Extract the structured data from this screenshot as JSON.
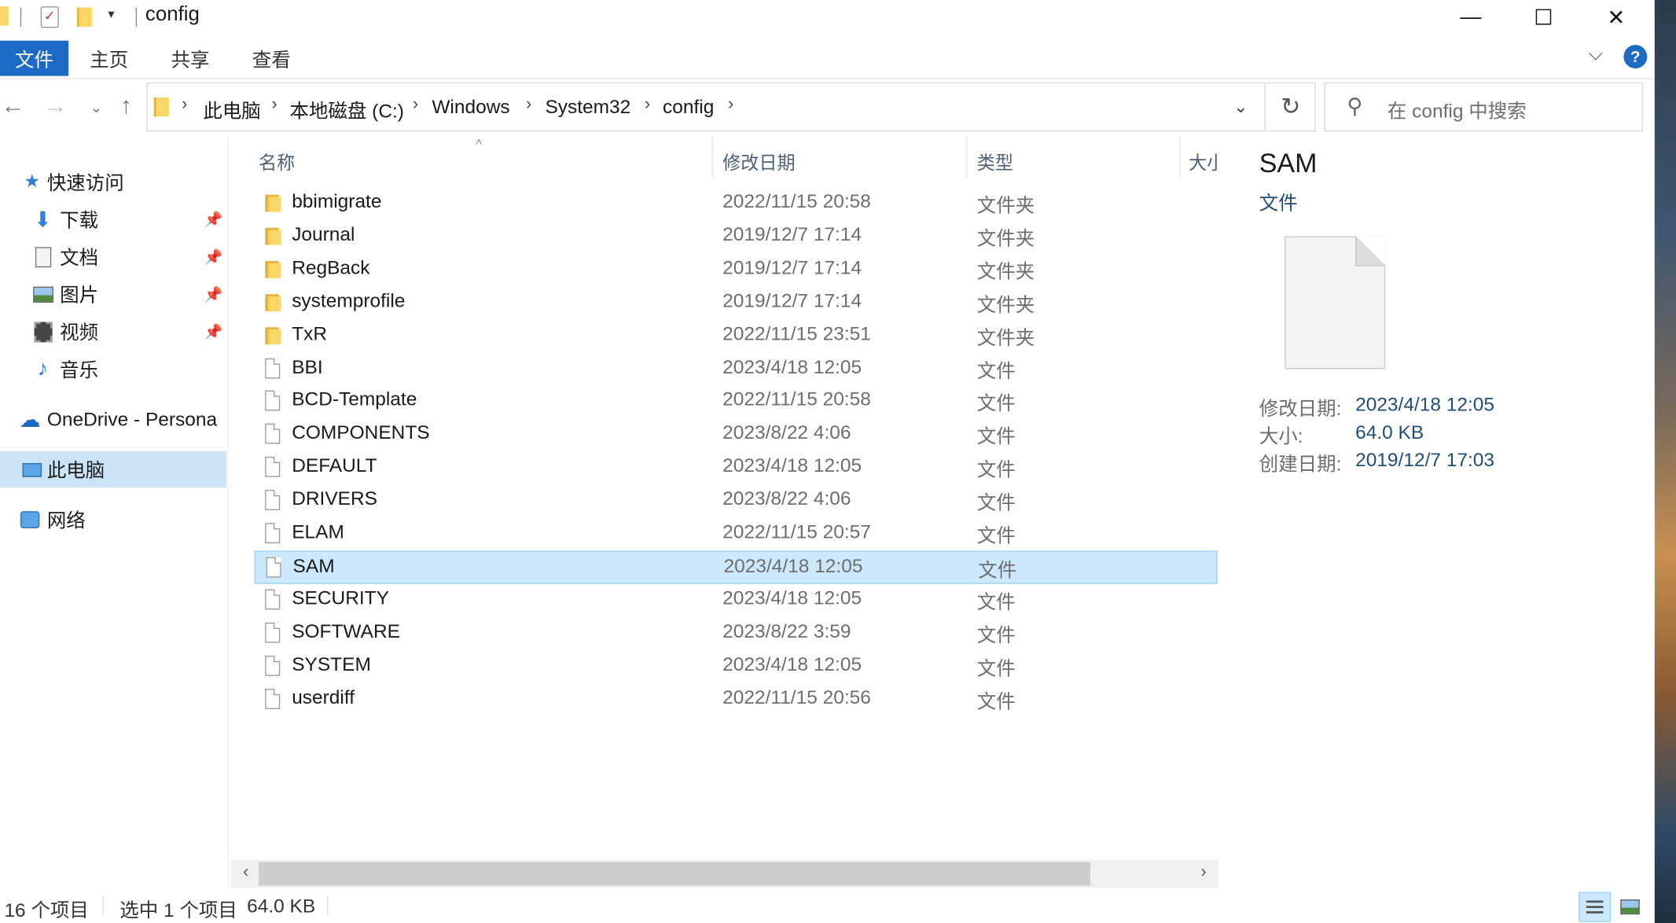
{
  "window": {
    "title": "config",
    "minimize": "—",
    "maximize": "☐",
    "close": "✕"
  },
  "ribbon": {
    "tabs": [
      "文件",
      "主页",
      "共享",
      "查看"
    ],
    "help": "?"
  },
  "address": {
    "crumbs": [
      "此电脑",
      "本地磁盘 (C:)",
      "Windows",
      "System32",
      "config"
    ],
    "search_placeholder": "在 config 中搜索"
  },
  "sidebar": {
    "quick_access": "快速访问",
    "items": [
      {
        "label": "下载",
        "icon": "download-icon",
        "pinned": true
      },
      {
        "label": "文档",
        "icon": "documents-icon",
        "pinned": true
      },
      {
        "label": "图片",
        "icon": "pictures-icon",
        "pinned": true
      },
      {
        "label": "视频",
        "icon": "videos-icon",
        "pinned": true
      },
      {
        "label": "音乐",
        "icon": "music-icon",
        "pinned": false
      }
    ],
    "onedrive": "OneDrive - Persona",
    "this_pc": "此电脑",
    "network": "网络"
  },
  "columns": {
    "name": "名称",
    "date": "修改日期",
    "type": "类型",
    "size": "大小"
  },
  "files": [
    {
      "name": "bbimigrate",
      "date": "2022/11/15 20:58",
      "type": "文件夹",
      "kind": "folder"
    },
    {
      "name": "Journal",
      "date": "2019/12/7 17:14",
      "type": "文件夹",
      "kind": "folder"
    },
    {
      "name": "RegBack",
      "date": "2019/12/7 17:14",
      "type": "文件夹",
      "kind": "folder"
    },
    {
      "name": "systemprofile",
      "date": "2019/12/7 17:14",
      "type": "文件夹",
      "kind": "folder"
    },
    {
      "name": "TxR",
      "date": "2022/11/15 23:51",
      "type": "文件夹",
      "kind": "folder"
    },
    {
      "name": "BBI",
      "date": "2023/4/18 12:05",
      "type": "文件",
      "kind": "file"
    },
    {
      "name": "BCD-Template",
      "date": "2022/11/15 20:58",
      "type": "文件",
      "kind": "file"
    },
    {
      "name": "COMPONENTS",
      "date": "2023/8/22 4:06",
      "type": "文件",
      "kind": "file"
    },
    {
      "name": "DEFAULT",
      "date": "2023/4/18 12:05",
      "type": "文件",
      "kind": "file"
    },
    {
      "name": "DRIVERS",
      "date": "2023/8/22 4:06",
      "type": "文件",
      "kind": "file"
    },
    {
      "name": "ELAM",
      "date": "2022/11/15 20:57",
      "type": "文件",
      "kind": "file"
    },
    {
      "name": "SAM",
      "date": "2023/4/18 12:05",
      "type": "文件",
      "kind": "file",
      "selected": true
    },
    {
      "name": "SECURITY",
      "date": "2023/4/18 12:05",
      "type": "文件",
      "kind": "file"
    },
    {
      "name": "SOFTWARE",
      "date": "2023/8/22 3:59",
      "type": "文件",
      "kind": "file"
    },
    {
      "name": "SYSTEM",
      "date": "2023/4/18 12:05",
      "type": "文件",
      "kind": "file"
    },
    {
      "name": "userdiff",
      "date": "2022/11/15 20:56",
      "type": "文件",
      "kind": "file"
    }
  ],
  "preview": {
    "title": "SAM",
    "type": "文件",
    "modified_label": "修改日期:",
    "modified_value": "2023/4/18 12:05",
    "size_label": "大小:",
    "size_value": "64.0 KB",
    "created_label": "创建日期:",
    "created_value": "2019/12/7 17:03"
  },
  "status": {
    "count": "16 个项目",
    "selection": "选中 1 个项目",
    "selection_size": "64.0 KB"
  },
  "colors": {
    "accent": "#1c69c6",
    "selection": "#cce8ff",
    "folder": "#fcd768"
  }
}
